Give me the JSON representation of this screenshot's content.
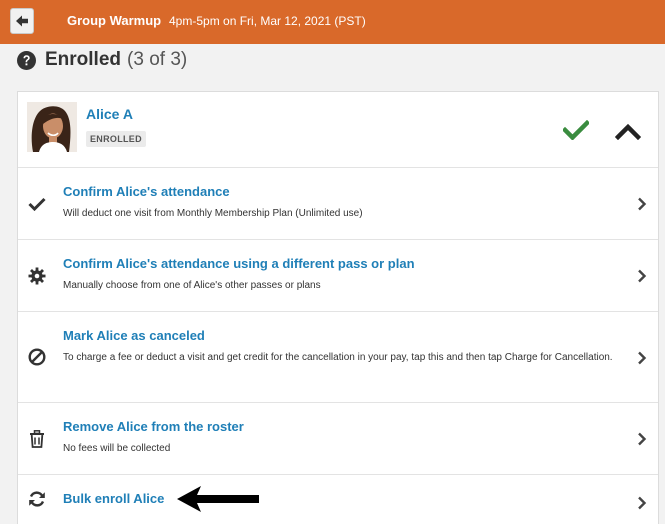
{
  "header": {
    "title": "Group Warmup",
    "subtitle": "4pm-5pm on Fri, Mar 12, 2021 (PST)",
    "background_color": "#d9692a",
    "back_icon": "arrow-left-icon"
  },
  "section": {
    "label": "Enrolled",
    "count": "(3 of 3)",
    "help_icon": "question-circle-icon"
  },
  "student": {
    "name": "Alice A",
    "status": "ENROLLED",
    "status_icon": "check-icon",
    "status_color": "#3a8c3f",
    "collapse_icon": "chevron-up-icon"
  },
  "actions": [
    {
      "icon": "check-icon",
      "title": "Confirm Alice's attendance",
      "description": "Will deduct one visit from Monthly Membership Plan (Unlimited use)"
    },
    {
      "icon": "gear-icon",
      "title": "Confirm Alice's attendance using a different pass or plan",
      "description": "Manually choose from one of Alice's other passes or plans"
    },
    {
      "icon": "ban-icon",
      "title": "Mark Alice as canceled",
      "description": "To charge a fee or deduct a visit and get credit for the cancellation in your pay, tap this and then tap Charge for Cancellation."
    },
    {
      "icon": "trash-icon",
      "title": "Remove Alice from the roster",
      "description": "No fees will be collected"
    },
    {
      "icon": "refresh-icon",
      "title": "Bulk enroll Alice",
      "description": ""
    }
  ],
  "colors": {
    "link": "#1f7fb7",
    "annotation": "#000000"
  }
}
